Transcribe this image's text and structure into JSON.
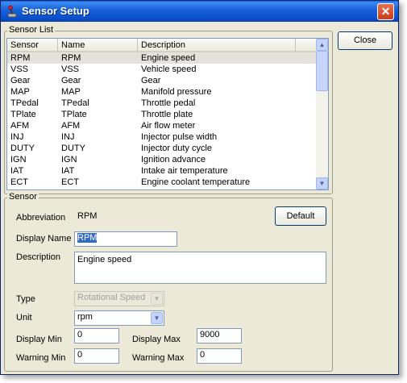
{
  "window": {
    "title": "Sensor Setup"
  },
  "buttons": {
    "close": "Close",
    "default": "Default",
    "close_glyph": "✕"
  },
  "sensor_list": {
    "group_label": "Sensor List",
    "columns": [
      "Sensor",
      "Name",
      "Description"
    ],
    "rows": [
      [
        "RPM",
        "RPM",
        "Engine speed"
      ],
      [
        "VSS",
        "VSS",
        "Vehicle speed"
      ],
      [
        "Gear",
        "Gear",
        "Gear"
      ],
      [
        "MAP",
        "MAP",
        "Manifold pressure"
      ],
      [
        "TPedal",
        "TPedal",
        "Throttle pedal"
      ],
      [
        "TPlate",
        "TPlate",
        "Throttle plate"
      ],
      [
        "AFM",
        "AFM",
        "Air flow meter"
      ],
      [
        "INJ",
        "INJ",
        "Injector pulse width"
      ],
      [
        "DUTY",
        "DUTY",
        "Injector duty cycle"
      ],
      [
        "IGN",
        "IGN",
        "Ignition advance"
      ],
      [
        "IAT",
        "IAT",
        "Intake air temperature"
      ],
      [
        "ECT",
        "ECT",
        "Engine coolant temperature"
      ]
    ]
  },
  "sensor": {
    "group_label": "Sensor",
    "abbreviation_label": "Abbreviation",
    "abbreviation_value": "RPM",
    "display_name_label": "Display Name",
    "display_name_value": "RPM",
    "description_label": "Description",
    "description_value": "Engine speed",
    "type_label": "Type",
    "type_value": "Rotational Speed",
    "unit_label": "Unit",
    "unit_value": "rpm",
    "display_min_label": "Display Min",
    "display_min_value": "0",
    "display_max_label": "Display Max",
    "display_max_value": "9000",
    "warning_min_label": "Warning Min",
    "warning_min_value": "0",
    "warning_max_label": "Warning Max",
    "warning_max_value": "0"
  },
  "icons": {
    "app": "joystick-icon",
    "scroll_up": "▲",
    "scroll_down": "▼",
    "dropdown": "▼"
  }
}
